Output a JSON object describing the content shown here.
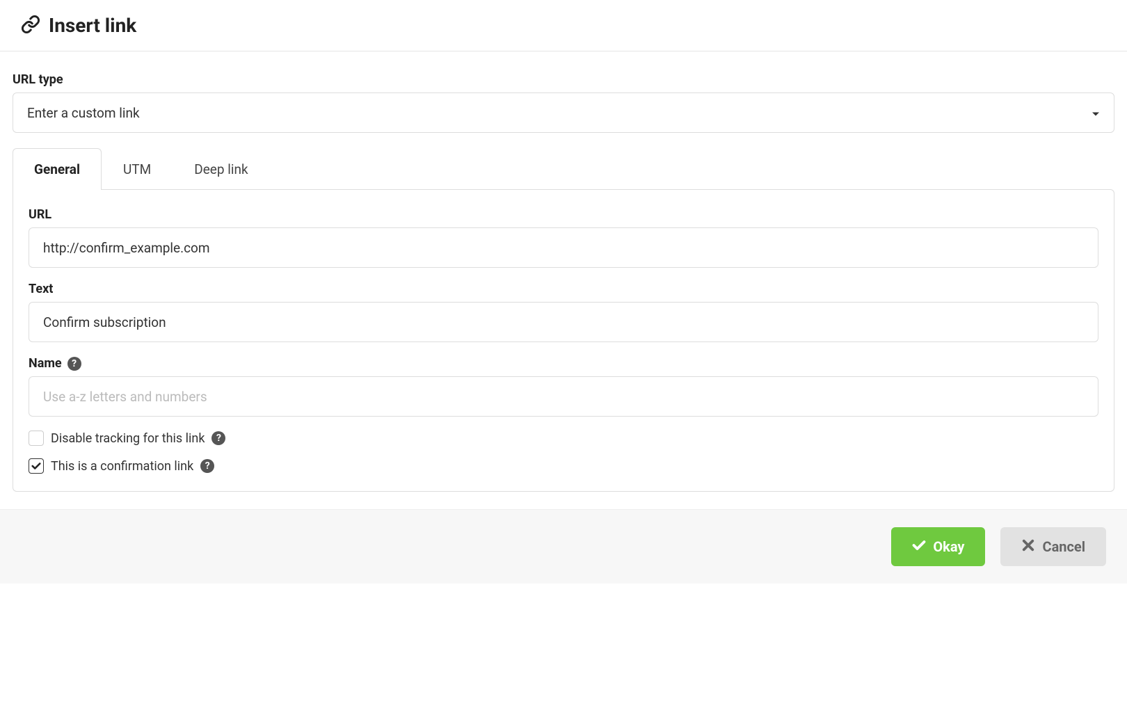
{
  "header": {
    "title": "Insert link"
  },
  "urlType": {
    "label": "URL type",
    "selected": "Enter a custom link"
  },
  "tabs": [
    {
      "label": "General",
      "active": true
    },
    {
      "label": "UTM",
      "active": false
    },
    {
      "label": "Deep link",
      "active": false
    }
  ],
  "general": {
    "urlLabel": "URL",
    "urlValue": "http://confirm_example.com",
    "textLabel": "Text",
    "textValue": "Confirm subscription",
    "nameLabel": "Name",
    "nameValue": "",
    "namePlaceholder": "Use a-z letters and numbers",
    "disableTracking": {
      "label": "Disable tracking for this link",
      "checked": false
    },
    "confirmationLink": {
      "label": "This is a confirmation link",
      "checked": true
    }
  },
  "footer": {
    "okay": "Okay",
    "cancel": "Cancel"
  }
}
